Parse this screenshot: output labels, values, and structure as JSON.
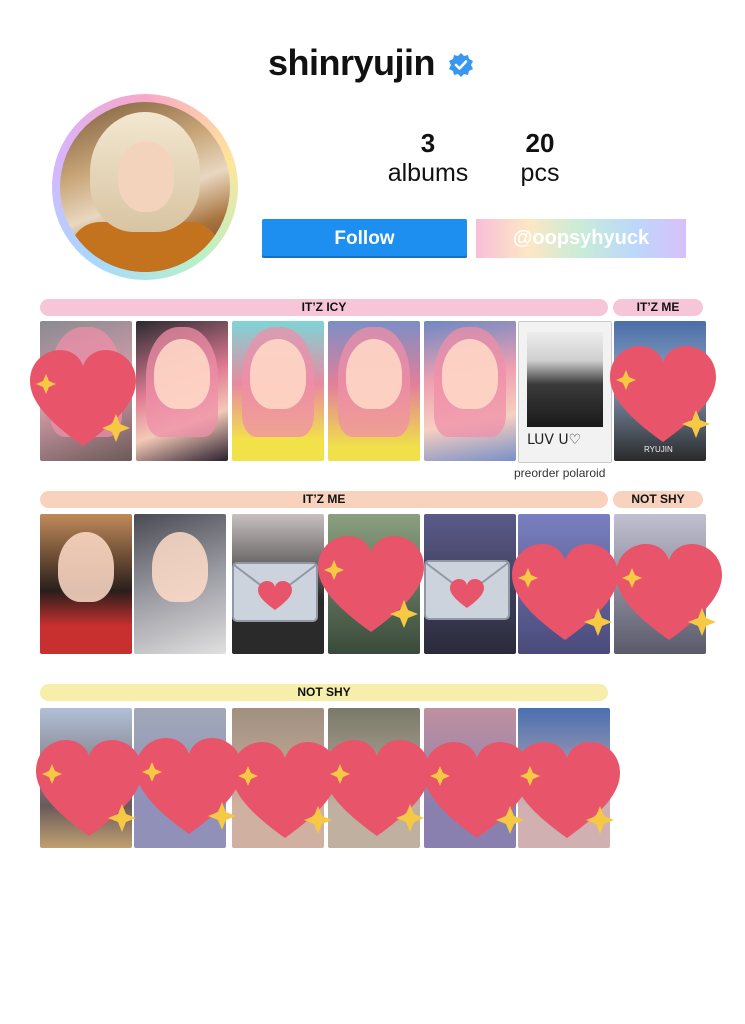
{
  "profile": {
    "username": "shinryujin",
    "stats": [
      {
        "value": "3",
        "label": "albums"
      },
      {
        "value": "20",
        "label": "pcs"
      }
    ],
    "follow_label": "Follow",
    "handle_label": "@oopsyhyuck"
  },
  "sections": [
    {
      "label": "IT’Z ICY",
      "color": "#f6c6d8"
    },
    {
      "label": "IT’Z ME",
      "color": "#f6c6d8"
    },
    {
      "label": "IT’Z ME",
      "color": "#f9d2bd"
    },
    {
      "label": "NOT SHY",
      "color": "#f9d2bd"
    },
    {
      "label": "NOT SHY",
      "color": "#f6eeaa"
    }
  ],
  "polaroid": {
    "caption": "preorder polaroid",
    "written_text": "LUV U♡"
  },
  "card_signature": "RYUJIN",
  "icons": [
    "verified-badge-icon",
    "heart-sparkle-icon",
    "envelope-heart-icon"
  ],
  "colors": {
    "follow": "#1c8ff0",
    "heart": "#e8556a",
    "sparkle": "#f6c844"
  }
}
